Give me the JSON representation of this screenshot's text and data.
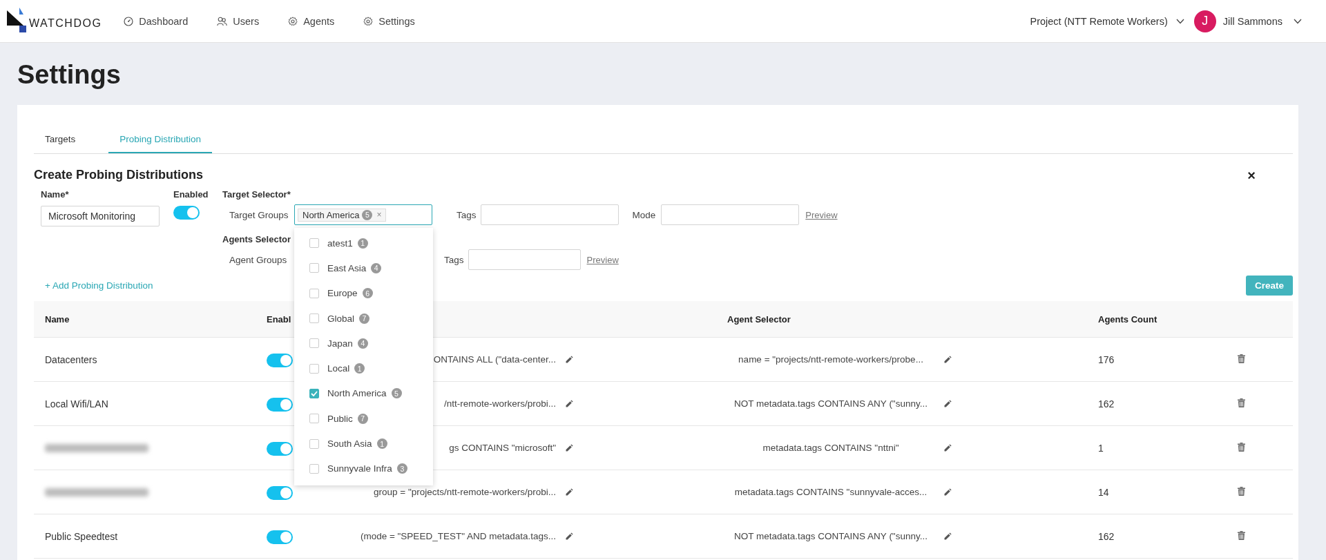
{
  "nav": {
    "brand": "WATCHDOG",
    "items": [
      {
        "label": "Dashboard"
      },
      {
        "label": "Users"
      },
      {
        "label": "Agents"
      },
      {
        "label": "Settings"
      }
    ],
    "project": "Project (NTT Remote Workers)",
    "user": {
      "initial": "J",
      "name": "Jill Sammons"
    }
  },
  "page_title": "Settings",
  "tabs": [
    {
      "label": "Targets",
      "selected": false
    },
    {
      "label": "Probing Distribution",
      "selected": true
    }
  ],
  "form": {
    "title": "Create Probing Distributions",
    "close": "×",
    "name_label": "Name*",
    "name_value": "Microsoft Monitoring",
    "enabled_label": "Enabled",
    "enabled_on": true,
    "target_selector_label": "Target Selector*",
    "target_groups_label": "Target Groups",
    "chips": [
      {
        "label": "North America",
        "count": "5",
        "remove": "×"
      }
    ],
    "tags_label": "Tags",
    "mode_label": "Mode",
    "preview": "Preview",
    "agents_selector_label": "Agents Selector",
    "agent_groups_label": "Agent Groups",
    "agent_tags_label": "Tags",
    "agent_preview": "Preview",
    "dropdown": [
      {
        "label": "atest1",
        "count": "1",
        "checked": false
      },
      {
        "label": "East Asia",
        "count": "4",
        "checked": false
      },
      {
        "label": "Europe",
        "count": "6",
        "checked": false
      },
      {
        "label": "Global",
        "count": "7",
        "checked": false
      },
      {
        "label": "Japan",
        "count": "4",
        "checked": false
      },
      {
        "label": "Local",
        "count": "1",
        "checked": false
      },
      {
        "label": "North America",
        "count": "5",
        "checked": true
      },
      {
        "label": "Public",
        "count": "7",
        "checked": false
      },
      {
        "label": "South Asia",
        "count": "1",
        "checked": false
      },
      {
        "label": "Sunnyvale Infra",
        "count": "3",
        "checked": false
      }
    ],
    "add_link": "+ Add Probing Distribution",
    "create": "Create"
  },
  "table": {
    "headers": {
      "name": "Name",
      "enabled": "Enabl",
      "agent_selector": "Agent Selector",
      "agents_count": "Agents Count"
    },
    "rows": [
      {
        "name": "Datacenters",
        "blurred": false,
        "enabled": true,
        "target_selector": "ONTAINS ALL (\"data-center...",
        "agent_selector": "name = \"projects/ntt-remote-workers/probe...",
        "agents_count": "176"
      },
      {
        "name": "Local Wifi/LAN",
        "blurred": false,
        "enabled": true,
        "target_selector": "/ntt-remote-workers/probi...",
        "agent_selector": "NOT metadata.tags CONTAINS ANY (\"sunny...",
        "agents_count": "162"
      },
      {
        "blurred": true,
        "enabled": true,
        "target_selector": "gs CONTAINS \"microsoft\"",
        "agent_selector": "metadata.tags CONTAINS \"nttni\"",
        "agents_count": "1"
      },
      {
        "blurred": true,
        "enabled": true,
        "target_selector": "group = \"projects/ntt-remote-workers/probi...",
        "agent_selector": "metadata.tags CONTAINS \"sunnyvale-acces...",
        "agents_count": "14"
      },
      {
        "name": "Public Speedtest",
        "blurred": false,
        "enabled": true,
        "target_selector": "(mode = \"SPEED_TEST\" AND metadata.tags...",
        "agent_selector": "NOT metadata.tags CONTAINS ANY (\"sunny...",
        "agents_count": "162"
      }
    ]
  }
}
